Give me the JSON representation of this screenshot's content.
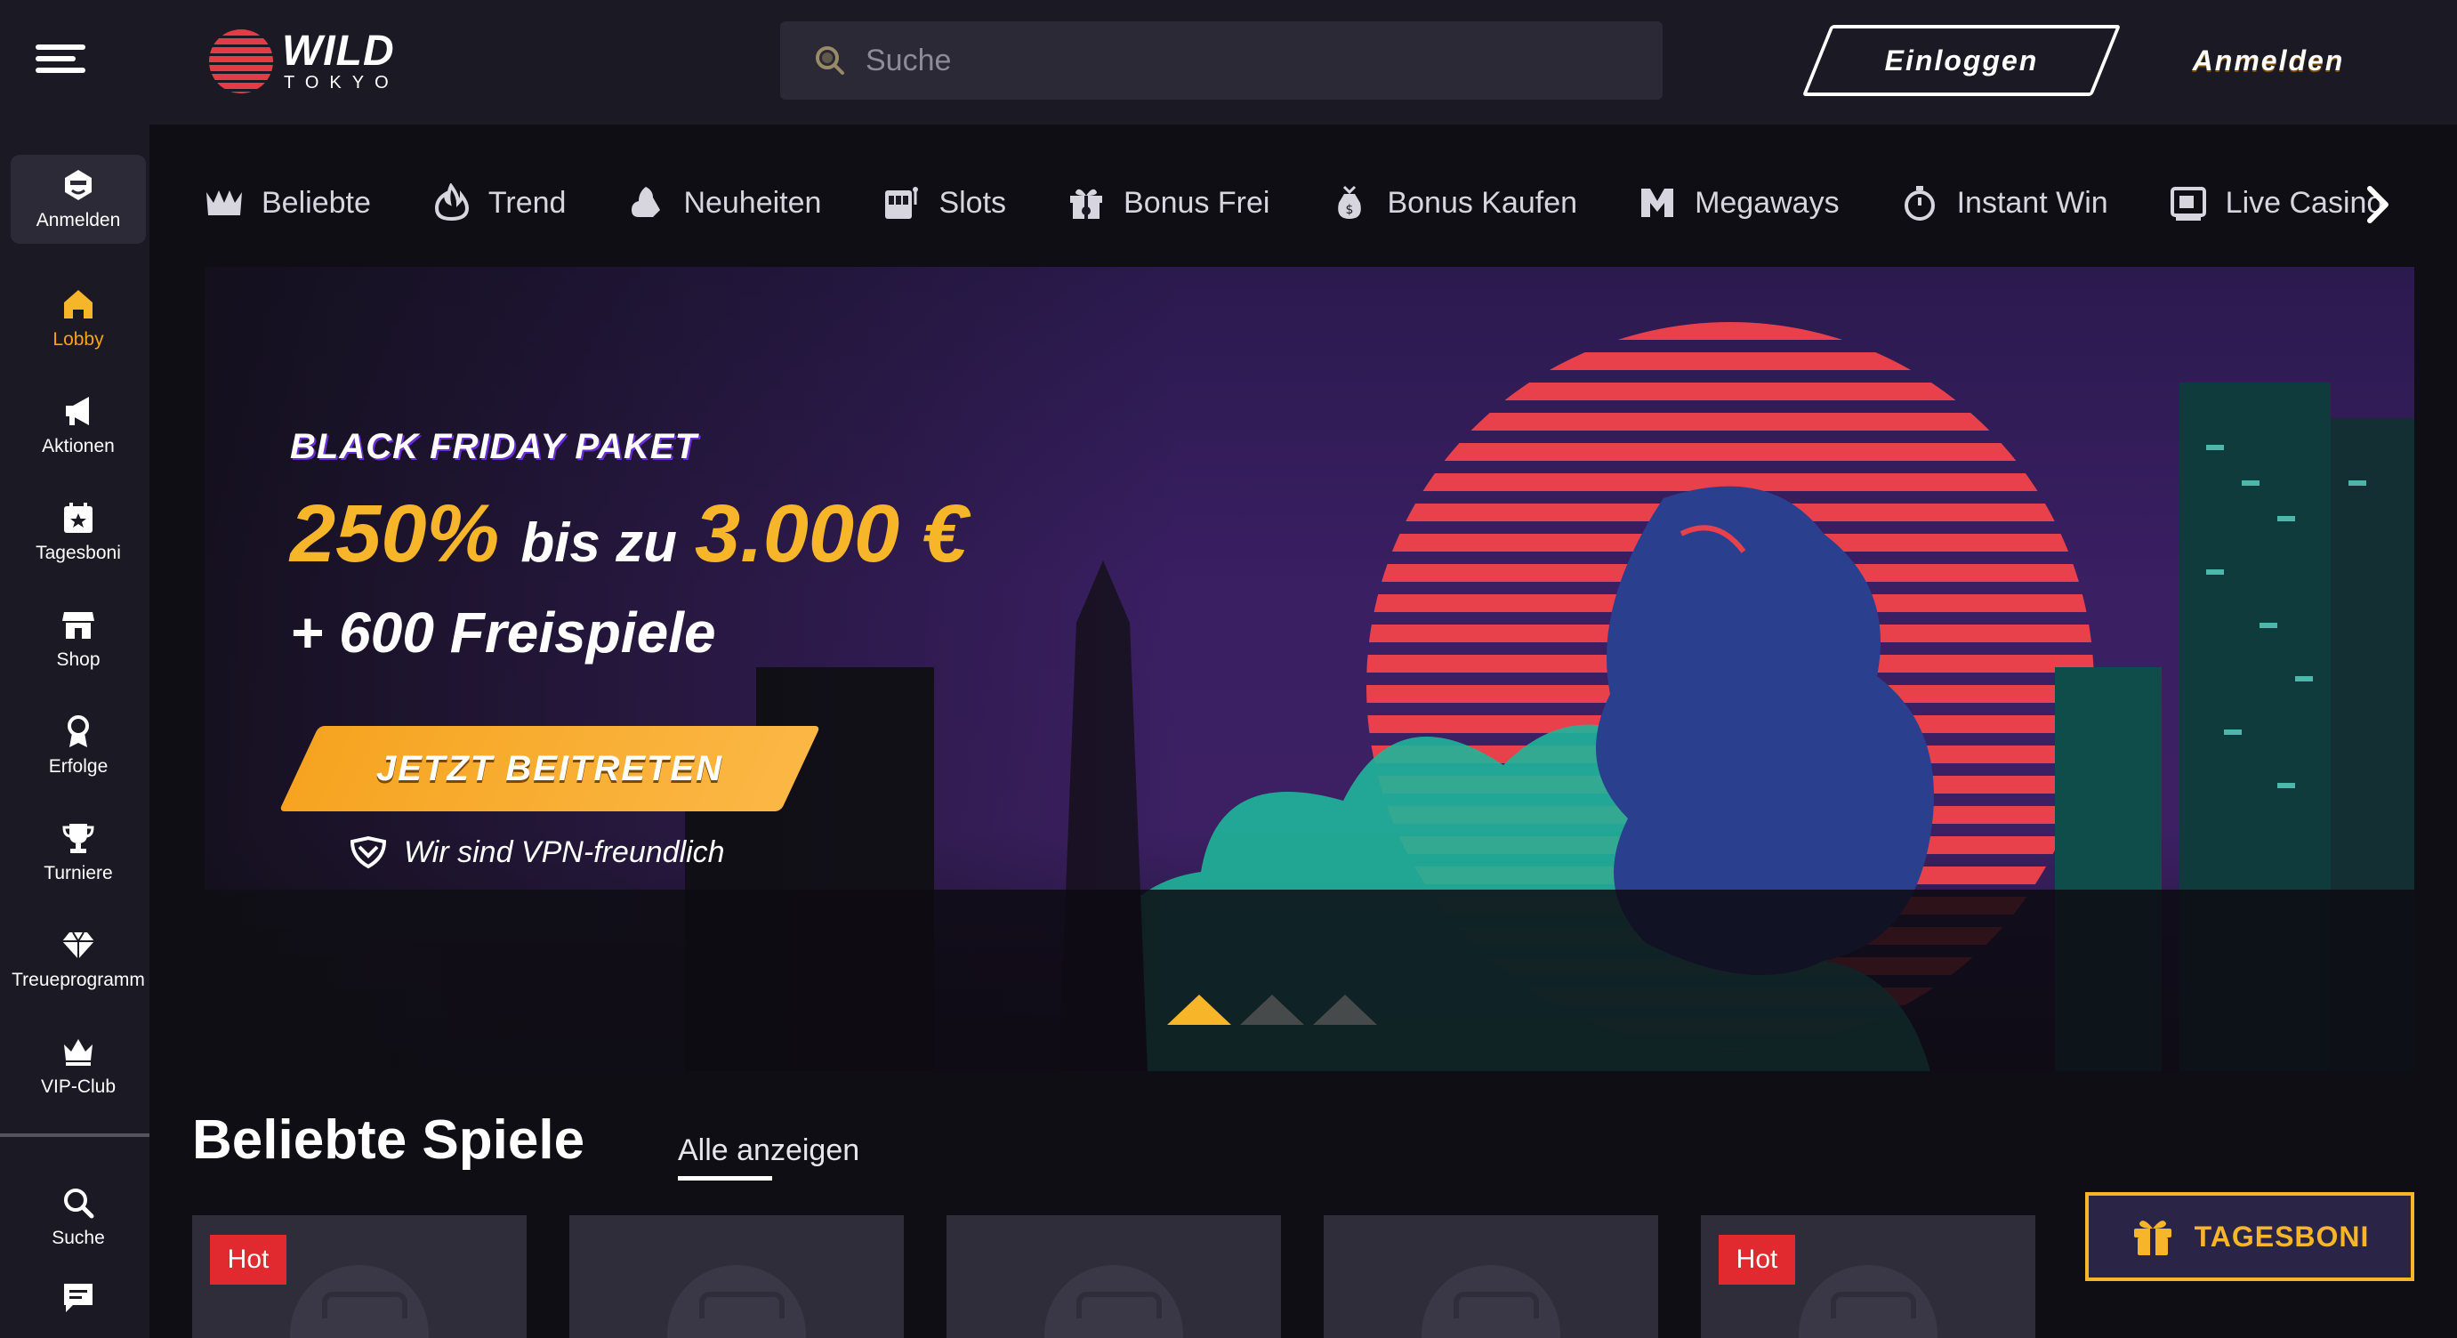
{
  "header": {
    "logo_wild": "WILD",
    "logo_tokyo": "TOKYO",
    "search_placeholder": "Suche",
    "login_label": "Einloggen",
    "signup_label": "Anmelden"
  },
  "sidebar": {
    "items": [
      {
        "label": "Anmelden",
        "icon": "user-icon"
      },
      {
        "label": "Lobby",
        "icon": "home-icon"
      },
      {
        "label": "Aktionen",
        "icon": "megaphone-icon"
      },
      {
        "label": "Tagesboni",
        "icon": "calendar-star-icon"
      },
      {
        "label": "Shop",
        "icon": "shop-icon"
      },
      {
        "label": "Erfolge",
        "icon": "medal-icon"
      },
      {
        "label": "Turniere",
        "icon": "trophy-icon"
      },
      {
        "label": "Treueprogramm",
        "icon": "diamond-icon"
      },
      {
        "label": "VIP-Club",
        "icon": "crown-icon"
      },
      {
        "label": "Suche",
        "icon": "search-icon"
      },
      {
        "label": "",
        "icon": "chat-icon"
      }
    ]
  },
  "categories": [
    {
      "label": "Beliebte",
      "icon": "crown-icon"
    },
    {
      "label": "Trend",
      "icon": "flame-icon"
    },
    {
      "label": "Neuheiten",
      "icon": "new-icon"
    },
    {
      "label": "Slots",
      "icon": "slot-machine-icon"
    },
    {
      "label": "Bonus Frei",
      "icon": "gift-icon"
    },
    {
      "label": "Bonus Kaufen",
      "icon": "money-bag-icon"
    },
    {
      "label": "Megaways",
      "icon": "megaways-icon"
    },
    {
      "label": "Instant Win",
      "icon": "stopwatch-icon"
    },
    {
      "label": "Live Casino",
      "icon": "live-icon"
    }
  ],
  "banner": {
    "kicker": "BLACK FRIDAY PAKET",
    "percent": "250%",
    "middle": "bis zu",
    "amount": "3.000 €",
    "spins": "+ 600 Freispiele",
    "cta": "JETZT BEITRETEN",
    "vpn": "Wir sind VPN-freundlich",
    "active_slide": 1,
    "slide_count": 3
  },
  "section": {
    "title": "Beliebte Spiele",
    "see_all": "Alle anzeigen",
    "tiles": [
      {
        "badge": "Hot"
      },
      {
        "badge": ""
      },
      {
        "badge": ""
      },
      {
        "badge": ""
      },
      {
        "badge": "Hot"
      }
    ]
  },
  "daily_bonus": {
    "label": "TAGESBONI"
  },
  "colors": {
    "accent": "#f7b529",
    "hot": "#e02a30",
    "background": "#1b1a24"
  }
}
